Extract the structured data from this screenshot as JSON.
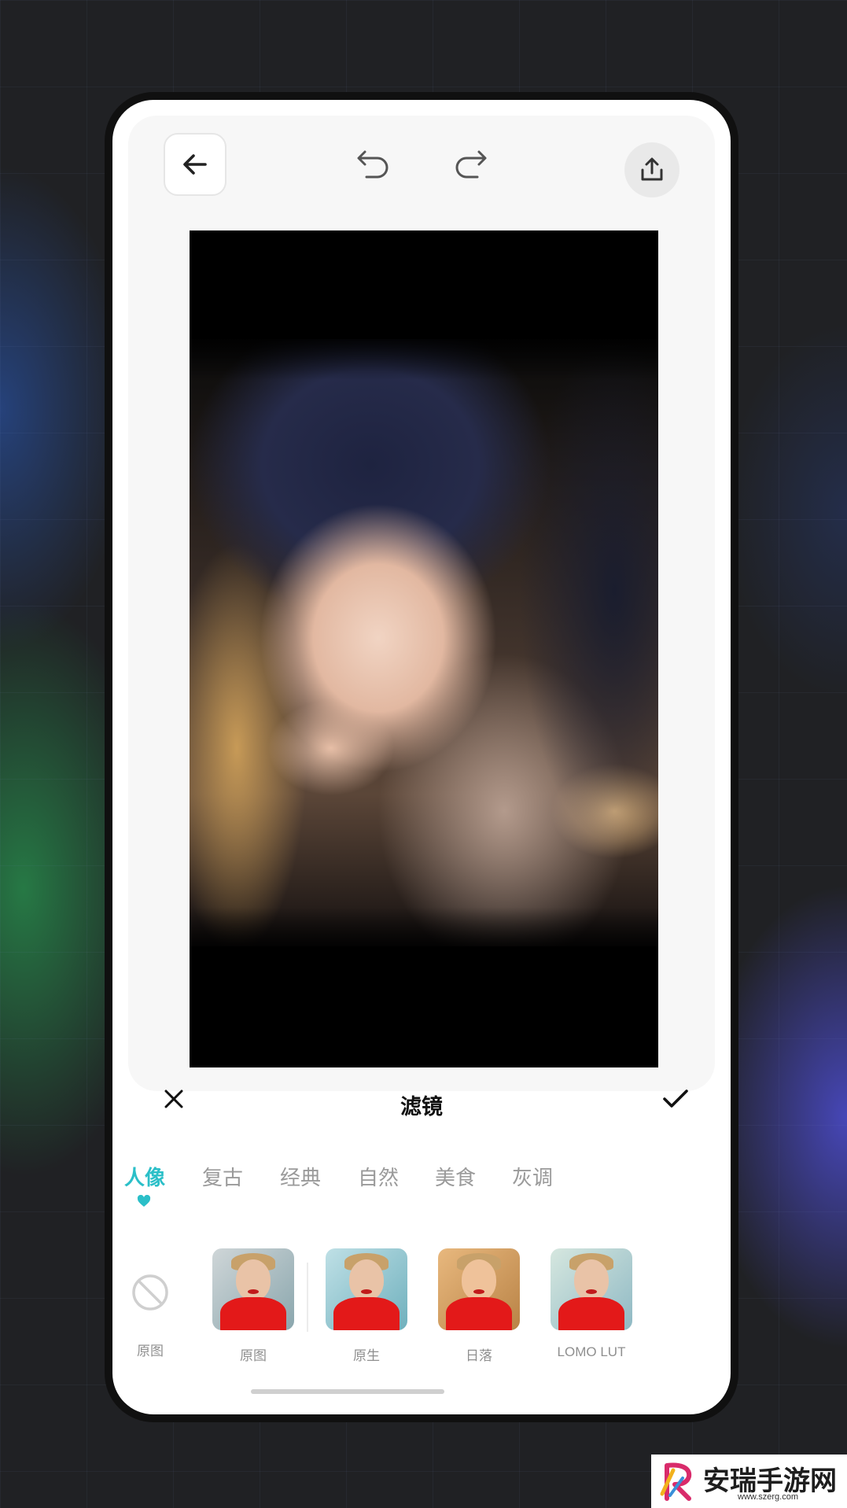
{
  "panel": {
    "title": "滤镜"
  },
  "tabs": [
    {
      "label": "人像",
      "active": true
    },
    {
      "label": "复古",
      "active": false
    },
    {
      "label": "经典",
      "active": false
    },
    {
      "label": "自然",
      "active": false
    },
    {
      "label": "美食",
      "active": false
    },
    {
      "label": "灰调",
      "active": false
    }
  ],
  "filters": {
    "none_label": "原图",
    "items": [
      {
        "label": "原图",
        "tone": "neutral"
      },
      {
        "label": "原生",
        "tone": "cool"
      },
      {
        "label": "日落",
        "tone": "warm"
      },
      {
        "label": "LOMO LUT",
        "tone": "lomo"
      }
    ]
  },
  "colors": {
    "accent": "#2bbfc8",
    "background": "#202124"
  },
  "icons": [
    "back-arrow-icon",
    "undo-icon",
    "redo-icon",
    "share-icon",
    "close-icon",
    "check-icon",
    "heart-icon",
    "no-filter-icon"
  ],
  "watermark": {
    "brand": "安瑞手游网",
    "url": "www.szerg.com"
  }
}
